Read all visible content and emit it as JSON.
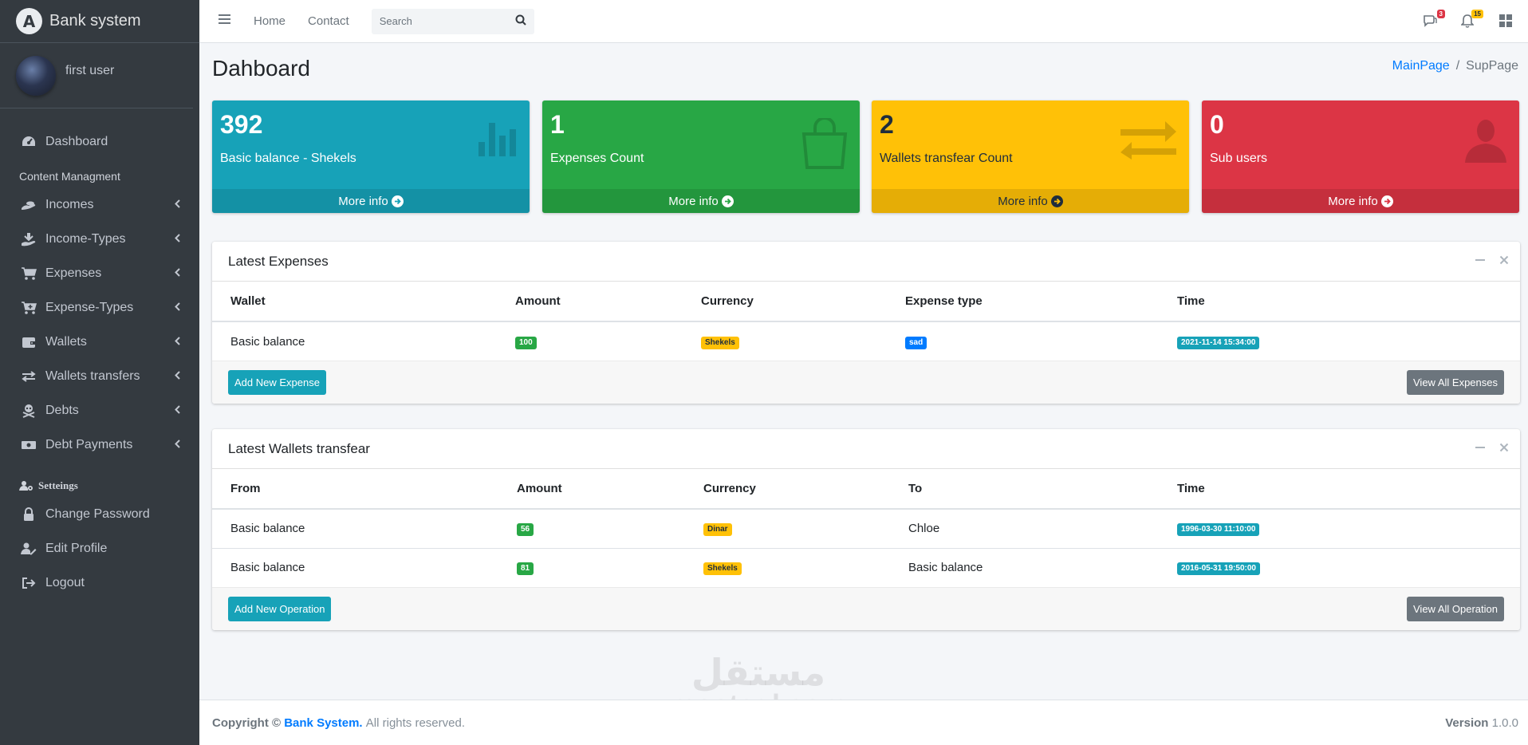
{
  "brand": {
    "logo_letter": "A",
    "name": "Bank system"
  },
  "user": {
    "name": "first user"
  },
  "sidebar": {
    "dashboard": "Dashboard",
    "section_content": "Content Managment",
    "items": [
      {
        "label": "Incomes",
        "icon": "money-hand-icon"
      },
      {
        "label": "Income-Types",
        "icon": "hand-holding-icon"
      },
      {
        "label": "Expenses",
        "icon": "cart-icon"
      },
      {
        "label": "Expense-Types",
        "icon": "cart-plus-icon"
      },
      {
        "label": "Wallets",
        "icon": "wallet-icon"
      },
      {
        "label": "Wallets transfers",
        "icon": "exchange-icon"
      },
      {
        "label": "Debts",
        "icon": "skull-icon"
      },
      {
        "label": "Debt Payments",
        "icon": "money-icon"
      }
    ],
    "section_settings": "Setteings",
    "settings_items": [
      {
        "label": "Change Password",
        "icon": "lock-icon"
      },
      {
        "label": "Edit Profile",
        "icon": "user-edit-icon"
      },
      {
        "label": "Logout",
        "icon": "sign-out-icon"
      }
    ]
  },
  "topbar": {
    "home": "Home",
    "contact": "Contact",
    "search_placeholder": "Search",
    "messages_count": "3",
    "notifications_count": "15"
  },
  "page": {
    "title": "Dahboard",
    "breadcrumb_main": "MainPage",
    "breadcrumb_sub": "SupPage"
  },
  "stats": [
    {
      "value": "392",
      "label": "Basic balance - Shekels",
      "more": "More info",
      "color": "#17a2b8"
    },
    {
      "value": "1",
      "label": "Expenses Count",
      "more": "More info",
      "color": "#28a745"
    },
    {
      "value": "2",
      "label": "Wallets transfear Count",
      "more": "More info",
      "color": "#ffc107"
    },
    {
      "value": "0",
      "label": "Sub users",
      "more": "More info",
      "color": "#dc3545"
    }
  ],
  "expenses": {
    "title": "Latest Expenses",
    "columns": [
      "Wallet",
      "Amount",
      "Currency",
      "Expense type",
      "Time"
    ],
    "rows": [
      {
        "wallet": "Basic balance",
        "amount": "100",
        "currency": "Shekels",
        "type": "sad",
        "time": "2021-11-14 15:34:00"
      }
    ],
    "add_button": "Add New Expense",
    "view_button": "View All Expenses"
  },
  "transfers": {
    "title": "Latest Wallets transfear",
    "columns": [
      "From",
      "Amount",
      "Currency",
      "To",
      "Time"
    ],
    "rows": [
      {
        "from": "Basic balance",
        "amount": "56",
        "currency": "Dinar",
        "to": "Chloe",
        "time": "1996-03-30 11:10:00"
      },
      {
        "from": "Basic balance",
        "amount": "81",
        "currency": "Shekels",
        "to": "Basic balance",
        "time": "2016-05-31 19:50:00"
      }
    ],
    "add_button": "Add New Operation",
    "view_button": "View All Operation"
  },
  "footer": {
    "copyright": "Copyright ©",
    "company": "Bank System.",
    "rights": "All rights reserved.",
    "version_label": "Version",
    "version": "1.0.0"
  },
  "watermark": {
    "arabic": "مستقل",
    "latin": "mostaql.com"
  }
}
